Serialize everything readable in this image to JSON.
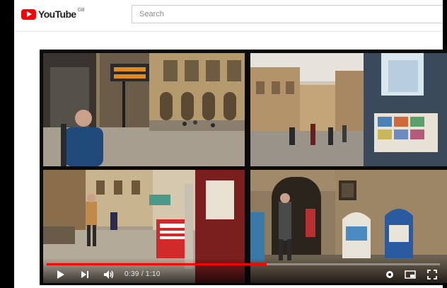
{
  "masthead": {
    "logo_text": "YouTube",
    "logo_region": "GB",
    "logo_icon": "youtube-play-icon",
    "search_placeholder": "Search"
  },
  "player": {
    "progress_fraction": 0.56,
    "time_display": "0:39 / 1:10",
    "icons": [
      "play-icon",
      "next-icon",
      "volume-icon",
      "settings-icon",
      "miniplayer-icon",
      "fullscreen-icon"
    ]
  },
  "colors": {
    "brand_red": "#ff0000",
    "player_background": "#0a0a0a"
  }
}
